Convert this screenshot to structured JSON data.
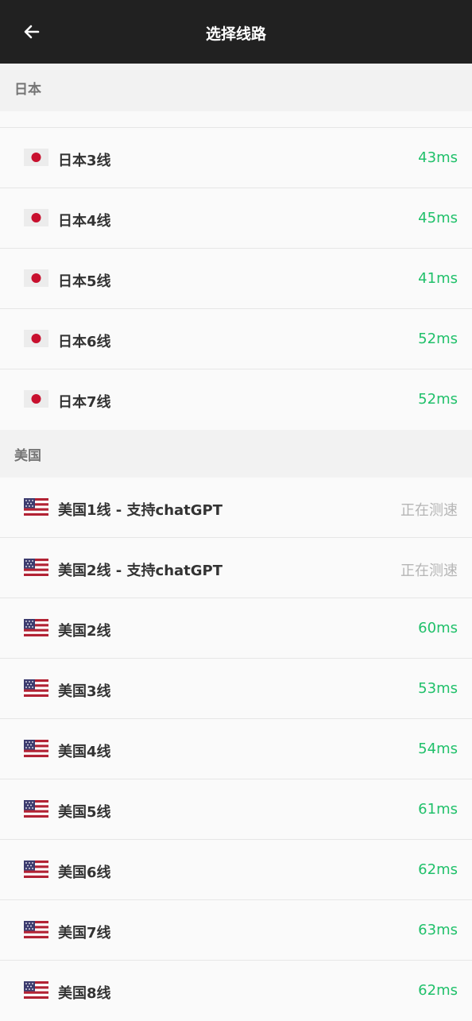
{
  "header": {
    "title": "选择线路",
    "back_icon": "arrow-left-icon"
  },
  "colors": {
    "topbar": "#212121",
    "latency": "#20c06a",
    "pending": "#b5b5b5",
    "section_bg": "#f2f2f2"
  },
  "sections": [
    {
      "title": "日本",
      "flag": "japan-flag-icon",
      "rows": [
        {
          "label": "日本3线",
          "status": "43ms",
          "state": "good"
        },
        {
          "label": "日本4线",
          "status": "45ms",
          "state": "good"
        },
        {
          "label": "日本5线",
          "status": "41ms",
          "state": "good"
        },
        {
          "label": "日本6线",
          "status": "52ms",
          "state": "good"
        },
        {
          "label": "日本7线",
          "status": "52ms",
          "state": "good"
        }
      ]
    },
    {
      "title": "美国",
      "flag": "usa-flag-icon",
      "rows": [
        {
          "label": "美国1线 - 支持chatGPT",
          "status": "正在测速",
          "state": "pending"
        },
        {
          "label": "美国2线 - 支持chatGPT",
          "status": "正在测速",
          "state": "pending"
        },
        {
          "label": "美国2线",
          "status": "60ms",
          "state": "good"
        },
        {
          "label": "美国3线",
          "status": "53ms",
          "state": "good"
        },
        {
          "label": "美国4线",
          "status": "54ms",
          "state": "good"
        },
        {
          "label": "美国5线",
          "status": "61ms",
          "state": "good"
        },
        {
          "label": "美国6线",
          "status": "62ms",
          "state": "good"
        },
        {
          "label": "美国7线",
          "status": "63ms",
          "state": "good"
        },
        {
          "label": "美国8线",
          "status": "62ms",
          "state": "good"
        }
      ]
    }
  ]
}
